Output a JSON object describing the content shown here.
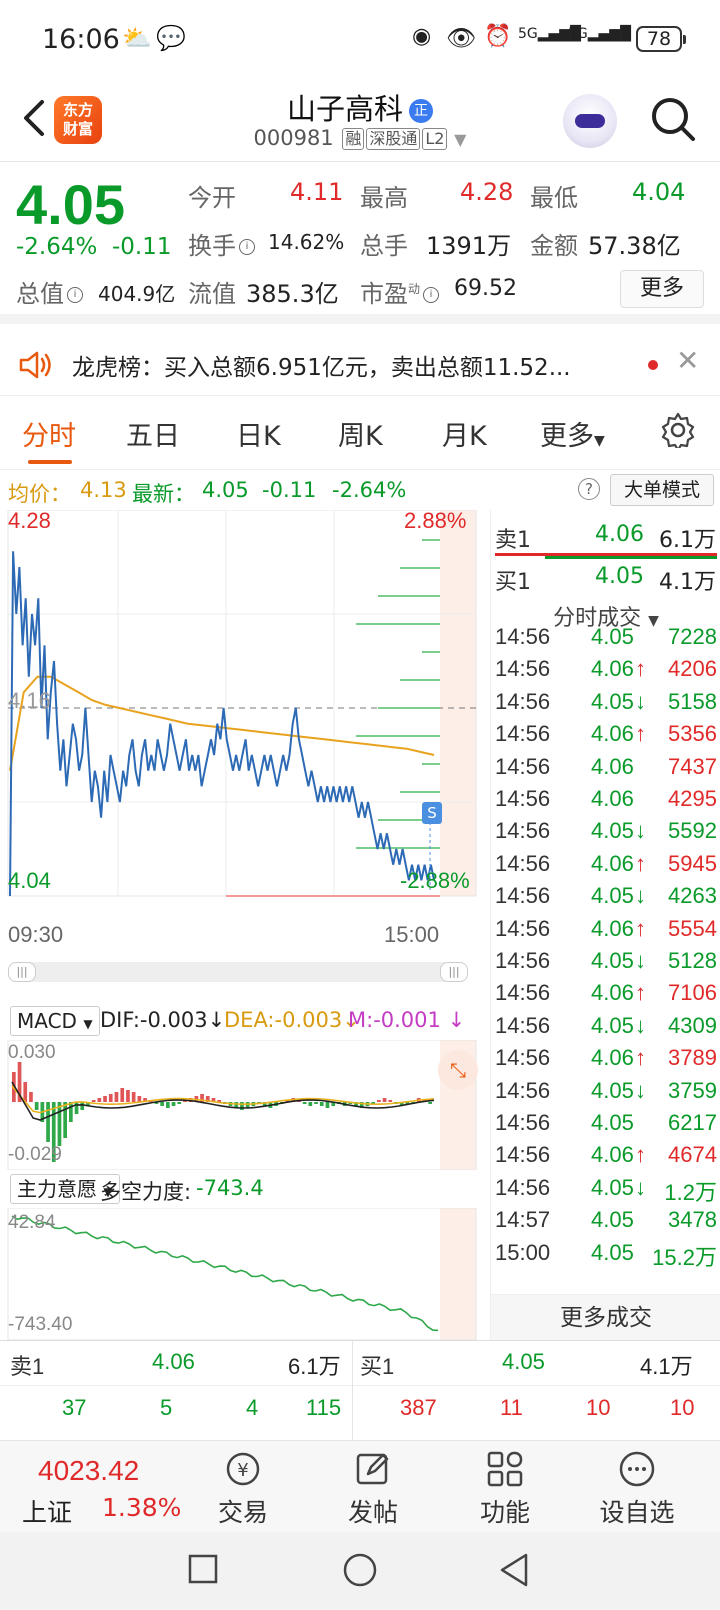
{
  "status": {
    "time": "16:06",
    "battery": "78",
    "net1": "5G",
    "net2": "5G"
  },
  "header": {
    "logo_line1": "东方",
    "logo_line2": "财富",
    "stock_name": "山子高科",
    "badge": "正",
    "code": "000981",
    "tag1": "融",
    "tag2": "深股通",
    "tag3": "L2"
  },
  "quote": {
    "price": "4.05",
    "change_pct": "-2.64%",
    "change": "-0.11",
    "open_label": "今开",
    "open": "4.11",
    "high_label": "最高",
    "high": "4.28",
    "low_label": "最低",
    "low": "4.04",
    "turnover_label": "换手",
    "turnover": "14.62%",
    "volume_label": "总手",
    "volume": "1391万",
    "amount_label": "金额",
    "amount": "57.38亿",
    "mktcap_label": "总值",
    "mktcap": "404.9亿",
    "float_label": "流值",
    "float": "385.3亿",
    "pe_label": "市盈",
    "pe_sup": "动",
    "pe": "69.52",
    "more": "更多"
  },
  "notice": {
    "text": "龙虎榜：买入总额6.951亿元，卖出总额11.52..."
  },
  "tabs": [
    "分时",
    "五日",
    "日K",
    "周K",
    "月K",
    "更多"
  ],
  "avgbar": {
    "avg_label": "均价：",
    "avg": "4.13",
    "latest_label": "最新：",
    "latest": "4.05",
    "chg": "-0.11",
    "pct": "-2.64%",
    "mode_btn": "大单模式"
  },
  "chart_data": {
    "type": "line",
    "title": "",
    "ylim": [
      4.04,
      4.28
    ],
    "y_ticks": {
      "top": "4.28",
      "mid": "4.16",
      "bottom": "4.04"
    },
    "pct_ticks": {
      "top": "2.88%",
      "bottom": "-2.88%"
    },
    "x_ticks": [
      "09:30",
      "15:00"
    ],
    "prev_close": 4.16,
    "series": [
      {
        "name": "price",
        "color": "#2d6ab5",
        "values": [
          4.04,
          4.26,
          4.22,
          4.25,
          4.2,
          4.23,
          4.18,
          4.22,
          4.2,
          4.23,
          4.16,
          4.2,
          4.14,
          4.17,
          4.19,
          4.15,
          4.12,
          4.14,
          4.11,
          4.13,
          4.15,
          4.14,
          4.12,
          4.13,
          4.16,
          4.13,
          4.1,
          4.12,
          4.11,
          4.09,
          4.12,
          4.1,
          4.13,
          4.12,
          4.11,
          4.1,
          4.12,
          4.11,
          4.13,
          4.14,
          4.12,
          4.11,
          4.13,
          4.14,
          4.12,
          4.13,
          4.12,
          4.14,
          4.13,
          4.12,
          4.13,
          4.15,
          4.14,
          4.13,
          4.12,
          4.13,
          4.14,
          4.12,
          4.13,
          4.12,
          4.13,
          4.11,
          4.12,
          4.13,
          4.14,
          4.13,
          4.15,
          4.14,
          4.16,
          4.14,
          4.13,
          4.12,
          4.13,
          4.12,
          4.13,
          4.14,
          4.12,
          4.13,
          4.12,
          4.11,
          4.12,
          4.13,
          4.12,
          4.13,
          4.12,
          4.11,
          4.12,
          4.13,
          4.12,
          4.13,
          4.15,
          4.16,
          4.14,
          4.13,
          4.12,
          4.11,
          4.12,
          4.11,
          4.1,
          4.11,
          4.1,
          4.11,
          4.1,
          4.11,
          4.1,
          4.11,
          4.1,
          4.11,
          4.1,
          4.11,
          4.1,
          4.09,
          4.1,
          4.09,
          4.1,
          4.09,
          4.08,
          4.07,
          4.08,
          4.07,
          4.08,
          4.07,
          4.06,
          4.07,
          4.06,
          4.07,
          4.06,
          4.05,
          4.06,
          4.05,
          4.06,
          4.05,
          4.06,
          4.05,
          4.06,
          4.05
        ]
      },
      {
        "name": "avg",
        "color": "#e9a21e",
        "values": [
          4.12,
          4.17,
          4.18,
          4.18,
          4.175,
          4.17,
          4.165,
          4.162,
          4.16,
          4.158,
          4.156,
          4.154,
          4.152,
          4.15,
          4.149,
          4.148,
          4.147,
          4.146,
          4.145,
          4.144,
          4.143,
          4.142,
          4.141,
          4.14,
          4.139,
          4.138,
          4.137,
          4.136,
          4.135,
          4.134,
          4.132,
          4.13
        ]
      }
    ],
    "macd": {
      "label": "MACD",
      "dif": "DIF:-0.003",
      "dea": "DEA:-0.003",
      "m": "M:-0.001",
      "top": "0.030",
      "bottom": "-0.029"
    },
    "flow": {
      "label": "主力意愿",
      "power_label": "多空力度:",
      "power": "-743.4",
      "top": "42.84",
      "bottom": "-743.40"
    }
  },
  "orderbook": {
    "sell1_label": "卖1",
    "sell1_price": "4.06",
    "sell1_vol": "6.1万",
    "buy1_label": "买1",
    "buy1_price": "4.05",
    "buy1_vol": "4.1万"
  },
  "trades_title": "分时成交",
  "trades": [
    {
      "t": "14:56",
      "p": "4.05",
      "v": "7228",
      "d": "",
      "c": "green"
    },
    {
      "t": "14:56",
      "p": "4.06",
      "v": "4206",
      "d": "↑",
      "c": "red"
    },
    {
      "t": "14:56",
      "p": "4.05",
      "v": "5158",
      "d": "↓",
      "c": "green"
    },
    {
      "t": "14:56",
      "p": "4.06",
      "v": "5356",
      "d": "↑",
      "c": "red"
    },
    {
      "t": "14:56",
      "p": "4.06",
      "v": "7437",
      "d": "",
      "c": "red"
    },
    {
      "t": "14:56",
      "p": "4.06",
      "v": "4295",
      "d": "",
      "c": "red"
    },
    {
      "t": "14:56",
      "p": "4.05",
      "v": "5592",
      "d": "↓",
      "c": "green"
    },
    {
      "t": "14:56",
      "p": "4.06",
      "v": "5945",
      "d": "↑",
      "c": "red"
    },
    {
      "t": "14:56",
      "p": "4.05",
      "v": "4263",
      "d": "↓",
      "c": "green"
    },
    {
      "t": "14:56",
      "p": "4.06",
      "v": "5554",
      "d": "↑",
      "c": "red"
    },
    {
      "t": "14:56",
      "p": "4.05",
      "v": "5128",
      "d": "↓",
      "c": "green"
    },
    {
      "t": "14:56",
      "p": "4.06",
      "v": "7106",
      "d": "↑",
      "c": "red"
    },
    {
      "t": "14:56",
      "p": "4.05",
      "v": "4309",
      "d": "↓",
      "c": "green"
    },
    {
      "t": "14:56",
      "p": "4.06",
      "v": "3789",
      "d": "↑",
      "c": "red"
    },
    {
      "t": "14:56",
      "p": "4.05",
      "v": "3759",
      "d": "↓",
      "c": "green"
    },
    {
      "t": "14:56",
      "p": "4.05",
      "v": "6217",
      "d": "",
      "c": "green"
    },
    {
      "t": "14:56",
      "p": "4.06",
      "v": "4674",
      "d": "↑",
      "c": "red"
    },
    {
      "t": "14:56",
      "p": "4.05",
      "v": "1.2万",
      "d": "↓",
      "c": "green"
    },
    {
      "t": "14:57",
      "p": "4.05",
      "v": "3478",
      "d": "",
      "c": "green"
    },
    {
      "t": "15:00",
      "p": "4.05",
      "v": "15.2万",
      "d": "",
      "c": "green"
    }
  ],
  "more_trades": "更多成交",
  "book": {
    "sell_label": "卖1",
    "sell_price": "4.06",
    "sell_vol": "6.1万",
    "sell_row": [
      "37",
      "5",
      "4",
      "115"
    ],
    "buy_label": "买1",
    "buy_price": "4.05",
    "buy_vol": "4.1万",
    "buy_row": [
      "387",
      "11",
      "10",
      "10"
    ]
  },
  "bottomnav": {
    "index_value": "4023.42",
    "index_name": "上证",
    "index_pct": "1.38%",
    "items": [
      "交易",
      "发帖",
      "功能",
      "设自选"
    ]
  },
  "colors": {
    "up": "#e02a2a",
    "down": "#0a9a2a",
    "accent": "#e8580e",
    "price_line": "#2d6ab5",
    "avg_line": "#e9a21e"
  }
}
